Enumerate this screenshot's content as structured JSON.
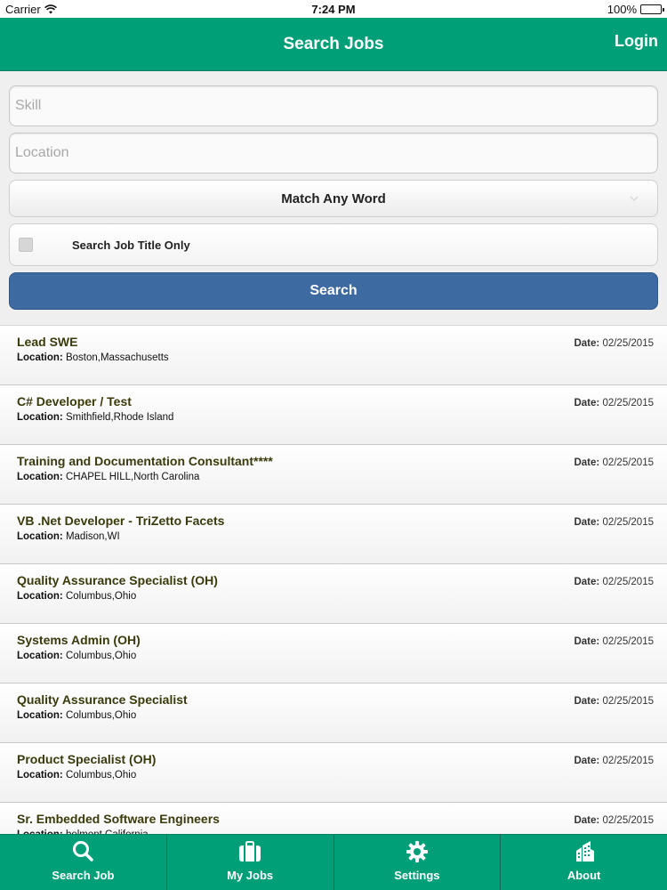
{
  "status_bar": {
    "carrier": "Carrier",
    "time": "7:24 PM",
    "battery": "100%"
  },
  "nav": {
    "title": "Search Jobs",
    "login": "Login"
  },
  "form": {
    "skill_placeholder": "Skill",
    "location_placeholder": "Location",
    "match_option": "Match Any Word",
    "title_only_label": "Search Job Title Only",
    "title_only_checked": false,
    "search_label": "Search"
  },
  "jobs": [
    {
      "title": "Lead SWE",
      "location_label": "Location:",
      "location": "Boston,Massachusetts",
      "date_label": "Date:",
      "date": "02/25/2015"
    },
    {
      "title": "C# Developer / Test",
      "location_label": "Location:",
      "location": "Smithfield,Rhode Island",
      "date_label": "Date:",
      "date": "02/25/2015"
    },
    {
      "title": "Training and Documentation Consultant****",
      "location_label": "Location:",
      "location": "CHAPEL HILL,North Carolina",
      "date_label": "Date:",
      "date": "02/25/2015"
    },
    {
      "title": "VB .Net Developer - TriZetto Facets",
      "location_label": "Location:",
      "location": "Madison,WI",
      "date_label": "Date:",
      "date": "02/25/2015"
    },
    {
      "title": "Quality Assurance Specialist (OH)",
      "location_label": "Location:",
      "location": "Columbus,Ohio",
      "date_label": "Date:",
      "date": "02/25/2015"
    },
    {
      "title": "Systems Admin (OH)",
      "location_label": "Location:",
      "location": "Columbus,Ohio",
      "date_label": "Date:",
      "date": "02/25/2015"
    },
    {
      "title": "Quality Assurance Specialist",
      "location_label": "Location:",
      "location": "Columbus,Ohio",
      "date_label": "Date:",
      "date": "02/25/2015"
    },
    {
      "title": "Product Specialist (OH)",
      "location_label": "Location:",
      "location": "Columbus,Ohio",
      "date_label": "Date:",
      "date": "02/25/2015"
    },
    {
      "title": "Sr. Embedded Software Engineers",
      "location_label": "Location:",
      "location": "belmont,California",
      "date_label": "Date:",
      "date": "02/25/2015"
    }
  ],
  "tabs": [
    {
      "label": "Search Job",
      "icon": "search-icon"
    },
    {
      "label": "My Jobs",
      "icon": "briefcase-icon"
    },
    {
      "label": "Settings",
      "icon": "gear-icon"
    },
    {
      "label": "About",
      "icon": "building-icon"
    }
  ],
  "colors": {
    "brand": "#009f77",
    "button": "#3d6aa1",
    "title_text": "#3a3a0c"
  }
}
